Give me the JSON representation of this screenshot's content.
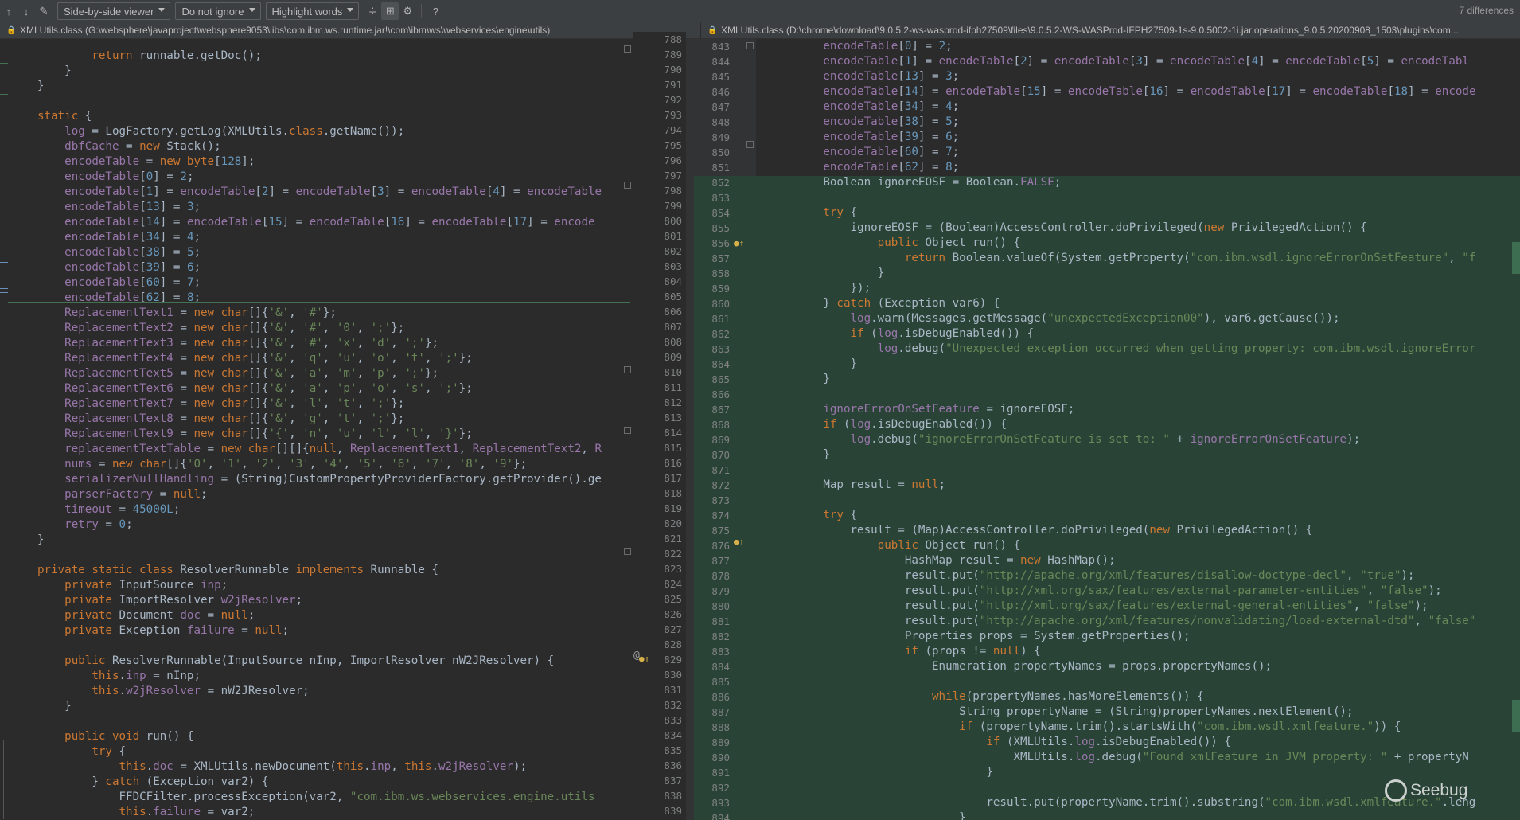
{
  "toolbar": {
    "viewer_mode": "Side-by-side viewer",
    "ignore_mode": "Do not ignore",
    "highlight_mode": "Highlight words",
    "help_label": "?",
    "differences": "7 differences"
  },
  "left_path": "XMLUtils.class (G:\\websphere\\javaproject\\websphere9053\\libs\\com.ibm.ws.runtime.jar!\\com\\ibm\\ws\\webservices\\engine\\utils)",
  "right_path": "XMLUtils.class (D:\\chrome\\download\\9.0.5.2-ws-wasprod-ifph27509\\files\\9.0.5.2-WS-WASProd-IFPH27509-1s-9.0.5002-1i.jar.operations_9.0.5.20200908_1503\\plugins\\com...",
  "left_line_numbers": [
    "788",
    "789",
    "790",
    "791",
    "792",
    "793",
    "794",
    "795",
    "796",
    "797",
    "798",
    "799",
    "800",
    "801",
    "802",
    "803",
    "804",
    "805",
    "806",
    "807",
    "808",
    "809",
    "810",
    "811",
    "812",
    "813",
    "814",
    "815",
    "816",
    "817",
    "818",
    "819",
    "820",
    "821",
    "822",
    "823",
    "824",
    "825",
    "826",
    "827",
    "828",
    "829",
    "830",
    "831",
    "832",
    "833",
    "834",
    "835",
    "836",
    "837",
    "838",
    "839"
  ],
  "right_line_numbers": [
    "843",
    "844",
    "845",
    "846",
    "847",
    "848",
    "849",
    "850",
    "851",
    "852",
    "853",
    "854",
    "855",
    "856",
    "857",
    "858",
    "859",
    "860",
    "861",
    "862",
    "863",
    "864",
    "865",
    "866",
    "867",
    "868",
    "869",
    "870",
    "871",
    "872",
    "873",
    "874",
    "875",
    "876",
    "877",
    "878",
    "879",
    "880",
    "881",
    "882",
    "883",
    "884",
    "885",
    "886",
    "887",
    "888",
    "889",
    "890",
    "891",
    "892",
    "893",
    "894"
  ],
  "watermark": "Seebug"
}
